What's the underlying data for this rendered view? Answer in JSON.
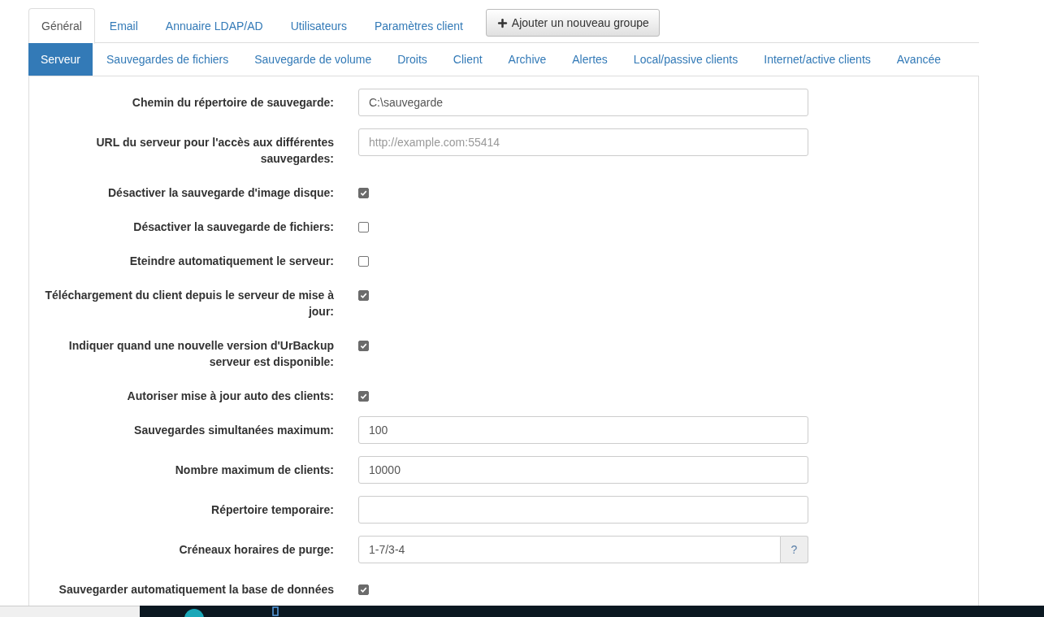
{
  "top_tabs": [
    {
      "label": "Général",
      "selected": true
    },
    {
      "label": "Email",
      "selected": false
    },
    {
      "label": "Annuaire LDAP/AD",
      "selected": false
    },
    {
      "label": "Utilisateurs",
      "selected": false
    },
    {
      "label": "Paramètres client",
      "selected": false
    }
  ],
  "add_group_button": {
    "label": "Ajouter un nouveau groupe"
  },
  "sub_tabs": [
    {
      "label": "Serveur",
      "selected": true
    },
    {
      "label": "Sauvegardes de fichiers",
      "selected": false
    },
    {
      "label": "Sauvegarde de volume",
      "selected": false
    },
    {
      "label": "Droits",
      "selected": false
    },
    {
      "label": "Client",
      "selected": false
    },
    {
      "label": "Archive",
      "selected": false
    },
    {
      "label": "Alertes",
      "selected": false
    },
    {
      "label": "Local/passive clients",
      "selected": false
    },
    {
      "label": "Internet/active clients",
      "selected": false
    },
    {
      "label": "Avancée",
      "selected": false
    }
  ],
  "settings": [
    {
      "kind": "text",
      "label": "Chemin du répertoire de sauvegarde:",
      "value": "C:\\sauvegarde"
    },
    {
      "kind": "text",
      "label": "URL du serveur pour l'accès aux différentes sauvegardes:",
      "placeholder": "http://example.com:55414"
    },
    {
      "kind": "checkbox",
      "label": "Désactiver la sauvegarde d'image disque:",
      "checked": true
    },
    {
      "kind": "checkbox",
      "label": "Désactiver la sauvegarde de fichiers:",
      "checked": false
    },
    {
      "kind": "checkbox",
      "label": "Eteindre automatiquement le serveur:",
      "checked": false
    },
    {
      "kind": "checkbox",
      "label": "Téléchargement du client depuis le serveur de mise à jour:",
      "checked": true
    },
    {
      "kind": "checkbox",
      "label": "Indiquer quand une nouvelle version d'UrBackup serveur est disponible:",
      "checked": true
    },
    {
      "kind": "checkbox",
      "label": "Autoriser mise à jour auto des clients:",
      "checked": true
    },
    {
      "kind": "text",
      "label": "Sauvegardes simultanées maximum:",
      "value": "100"
    },
    {
      "kind": "text",
      "label": "Nombre maximum de clients:",
      "value": "10000"
    },
    {
      "kind": "text",
      "label": "Répertoire temporaire:"
    },
    {
      "kind": "text",
      "label": "Créneaux horaires de purge:",
      "value": "1-7/3-4",
      "help": "?"
    },
    {
      "kind": "checkbox",
      "label": "Sauvegarder automatiquement la base de données",
      "checked": true
    }
  ]
}
